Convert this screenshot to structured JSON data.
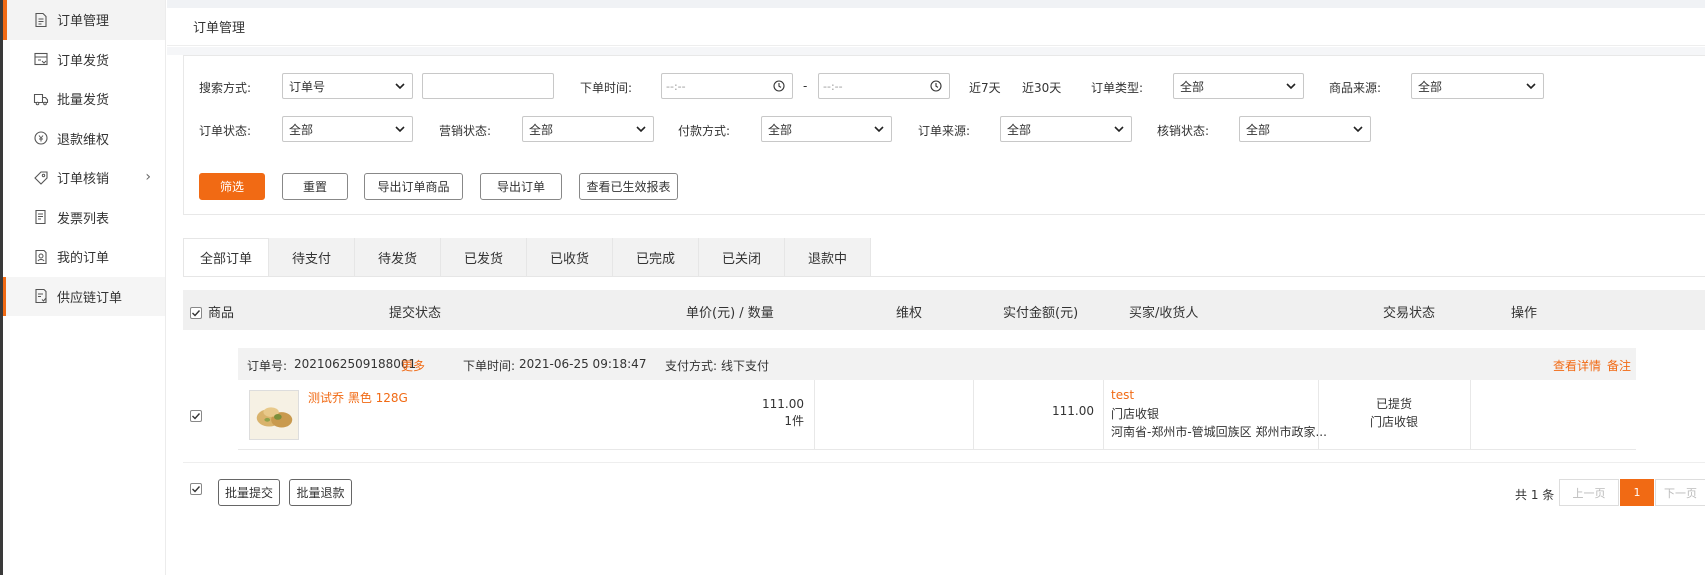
{
  "sidebar": {
    "items": [
      {
        "label": "订单管理",
        "icon": "document-icon"
      },
      {
        "label": "订单发货",
        "icon": "truck-box-icon"
      },
      {
        "label": "批量发货",
        "icon": "truck-icon"
      },
      {
        "label": "退款维权",
        "icon": "refund-icon"
      },
      {
        "label": "订单核销",
        "icon": "tag-icon"
      },
      {
        "label": "发票列表",
        "icon": "invoice-icon"
      },
      {
        "label": "我的订单",
        "icon": "my-order-icon"
      },
      {
        "label": "供应链订单",
        "icon": "supply-order-icon"
      }
    ]
  },
  "breadcrumb": "订单管理",
  "filters": {
    "search_mode_label": "搜索方式:",
    "search_mode_value": "订单号",
    "search_keyword_value": "",
    "order_time_label": "下单时间:",
    "date_placeholder": "--:--",
    "date_separator": "-",
    "quick_7": "近7天",
    "quick_30": "近30天",
    "order_type_label": "订单类型:",
    "order_type_value": "全部",
    "goods_source_label": "商品来源:",
    "goods_source_value": "全部",
    "order_status_label": "订单状态:",
    "order_status_value": "全部",
    "marketing_status_label": "营销状态:",
    "marketing_status_value": "全部",
    "pay_method_label": "付款方式:",
    "pay_method_value": "全部",
    "order_source_label": "订单来源:",
    "order_source_value": "全部",
    "verify_status_label": "核销状态:",
    "verify_status_value": "全部"
  },
  "buttons": {
    "filter": "筛选",
    "reset": "重置",
    "export_goods": "导出订单商品",
    "export_orders": "导出订单",
    "view_reports": "查看已生效报表"
  },
  "tabs": [
    "全部订单",
    "待支付",
    "待发货",
    "已发货",
    "已收货",
    "已完成",
    "已关闭",
    "退款中"
  ],
  "table_headers": {
    "goods": "商品",
    "submit_status": "提交状态",
    "price_qty": "单价(元) / 数量",
    "rights": "维权",
    "paid_amount": "实付金额(元)",
    "buyer": "买家/收货人",
    "trade_status": "交易状态",
    "actions": "操作"
  },
  "order": {
    "order_no_label": "订单号:",
    "order_no": "2021062509188001",
    "more": "更多",
    "order_time_label": "下单时间:",
    "order_time": "2021-06-25 09:18:47",
    "pay_method_label": "支付方式:",
    "pay_method": "线下支付",
    "view_detail": "查看详情",
    "remark": "备注",
    "item_name": "测试乔 黑色 128G",
    "unit_price": "111.00",
    "quantity": "1件",
    "paid_amount": "111.00",
    "buyer_name": "test",
    "receiver": "门店收银",
    "address": "河南省-郑州市-管城回族区 郑州市政家...",
    "status_line1": "已提货",
    "status_line2": "门店收银"
  },
  "bulk": {
    "submit": "批量提交",
    "refund": "批量退款"
  },
  "pagination": {
    "total": "共 1 条",
    "prev": "上一页",
    "current": "1",
    "next": "下一页"
  },
  "colors": {
    "accent": "#f16a14"
  }
}
